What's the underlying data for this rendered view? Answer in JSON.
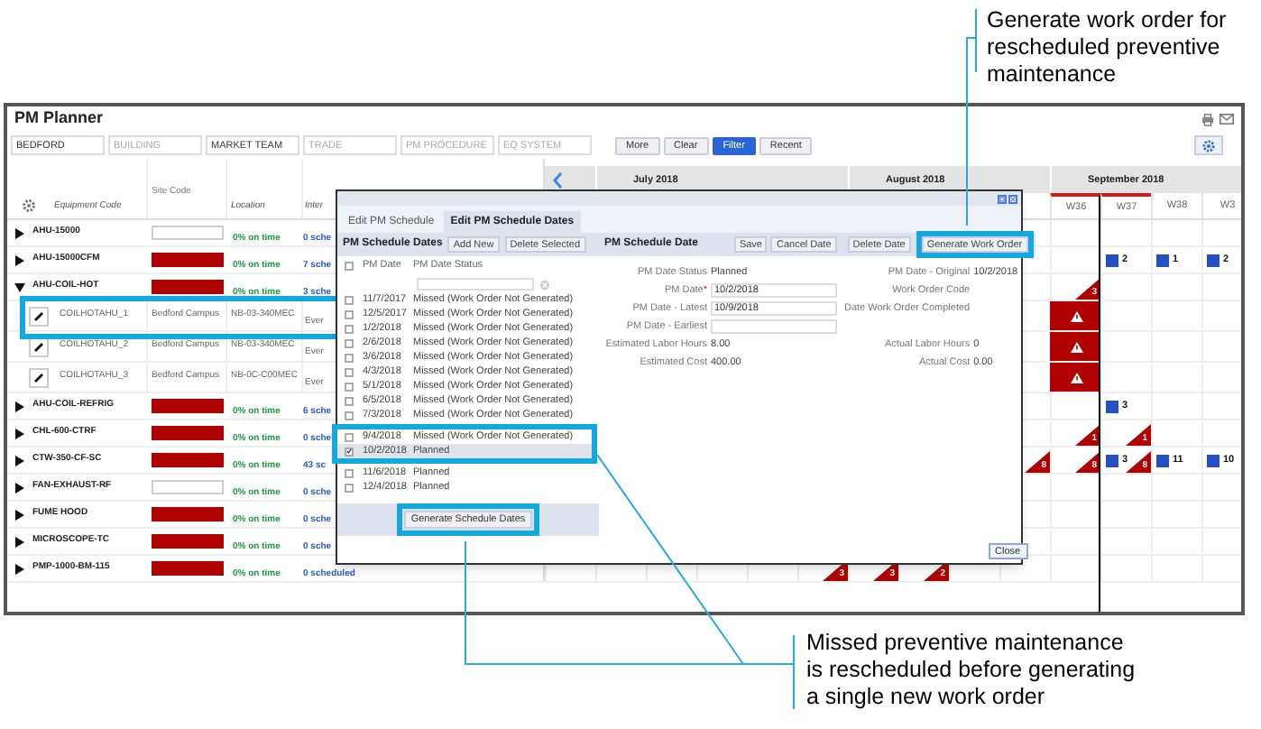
{
  "callouts": [
    {
      "lines": [
        "Generate work order for",
        "rescheduled preventive",
        "maintenance"
      ]
    },
    {
      "lines": [
        "Missed preventive maintenance",
        "is rescheduled before generating",
        "a single new work order"
      ]
    }
  ],
  "app": {
    "title": "PM Planner",
    "filters": [
      {
        "value": "BEDFORD"
      },
      {
        "placeholder": "BUILDING"
      },
      {
        "value": "MARKET TEAM"
      },
      {
        "placeholder": "TRADE"
      },
      {
        "placeholder": "PM PROCEDURE"
      },
      {
        "placeholder": "EQ SYSTEM"
      }
    ],
    "buttons": [
      {
        "label": "More",
        "selected": false
      },
      {
        "label": "Clear",
        "selected": false
      },
      {
        "label": "Filter",
        "selected": true
      },
      {
        "label": "Recent",
        "selected": false
      }
    ],
    "table": {
      "columns": [
        {
          "label": "Equipment Code"
        },
        {
          "label": "Site Code"
        },
        {
          "label": "Location"
        },
        {
          "label": "Inter"
        }
      ],
      "rows": [
        {
          "kind": "group",
          "code": "AHU-15000",
          "expanded": false,
          "flagged": false,
          "on_time": "0% on time",
          "scheduled": "0 sche"
        },
        {
          "kind": "group",
          "code": "AHU-15000CFM",
          "expanded": false,
          "flagged": true,
          "on_time": "0% on time",
          "scheduled": "7 sche",
          "markers": [
            {
              "kind": "count",
              "text": "2"
            },
            {
              "kind": "count",
              "text": "1"
            },
            {
              "kind": "count",
              "text": "2"
            }
          ]
        },
        {
          "kind": "group",
          "code": "AHU-COIL-HOT",
          "expanded": true,
          "flagged": true,
          "on_time": "0% on time",
          "scheduled": "3 sche",
          "markers": [
            {
              "kind": "overdue",
              "text": "3"
            }
          ]
        },
        {
          "kind": "item",
          "code": "COILHOTAHU_1",
          "site": "Bedford Campus",
          "location": "NB-03-340MEC",
          "column_4": "Ever",
          "markers": [
            {
              "kind": "alert"
            }
          ]
        },
        {
          "kind": "item",
          "code": "COILHOTAHU_2",
          "site": "Bedford Campus",
          "location": "NB-03-340MEC",
          "column_4": "Ever",
          "markers": [
            {
              "kind": "alert"
            }
          ]
        },
        {
          "kind": "item",
          "code": "COILHOTAHU_3",
          "site": "Bedford Campus",
          "location": "NB-0C-C00MEC",
          "column_4": "Ever",
          "markers": [
            {
              "kind": "alert"
            }
          ]
        },
        {
          "kind": "group",
          "code": "AHU-COIL-REFRIG",
          "expanded": false,
          "flagged": true,
          "on_time": "0% on time",
          "scheduled": "6 sche",
          "markers": [
            {
              "kind": "count",
              "text": "3"
            }
          ]
        },
        {
          "kind": "group",
          "code": "CHL-600-CTRF",
          "expanded": false,
          "flagged": true,
          "on_time": "0% on time",
          "scheduled": "0 sche",
          "markers": [
            {
              "kind": "overdue",
              "text": "1"
            },
            {
              "kind": "overdue",
              "text": "1"
            }
          ]
        },
        {
          "kind": "group",
          "code": "CTW-350-CF-SC",
          "expanded": false,
          "flagged": true,
          "on_time": "0% on time",
          "scheduled": "43 sc",
          "markers": [
            {
              "kind": "overdue",
              "text": "8"
            },
            {
              "kind": "overdue",
              "text": "8"
            },
            {
              "kind": "count",
              "text": "3"
            },
            {
              "kind": "overdue",
              "text": "8"
            },
            {
              "kind": "count",
              "text": "11"
            },
            {
              "kind": "count",
              "text": "10"
            }
          ]
        },
        {
          "kind": "group",
          "code": "FAN-EXHAUST-RF",
          "expanded": false,
          "flagged": false,
          "on_time": "0% on time",
          "scheduled": "0 sche"
        },
        {
          "kind": "group",
          "code": "FUME HOOD",
          "expanded": false,
          "flagged": true,
          "on_time": "0% on time",
          "scheduled": "0 sche"
        },
        {
          "kind": "group",
          "code": "MICROSCOPE-TC",
          "expanded": false,
          "flagged": true,
          "on_time": "0% on time",
          "scheduled": "0 sche"
        },
        {
          "kind": "group",
          "code": "PMP-1000-BM-115",
          "expanded": false,
          "flagged": true,
          "on_time": "0% on time",
          "scheduled": "0 scheduled",
          "markers": [
            {
              "kind": "overdue",
              "text": "3"
            },
            {
              "kind": "overdue",
              "text": "3"
            },
            {
              "kind": "overdue",
              "text": "2"
            }
          ]
        }
      ]
    },
    "timeline": {
      "months": [
        "July 2018",
        "August 2018",
        "September 2018"
      ],
      "weeks": [
        "W36",
        "W37",
        "W38",
        "W3"
      ]
    }
  },
  "dialog": {
    "tabs": [
      {
        "label": "Edit PM Schedule",
        "selected": false
      },
      {
        "label": "Edit PM Schedule Dates",
        "selected": true
      }
    ],
    "list_panel": {
      "title": "PM Schedule Dates",
      "buttons": [
        "Add New",
        "Delete Selected"
      ],
      "columns": [
        "PM Date",
        "PM Date Status"
      ],
      "all_checked": false,
      "rows": [
        {
          "date": "11/7/2017",
          "status": "Missed (Work Order Not Generated)",
          "checked": false,
          "selected": false
        },
        {
          "date": "12/5/2017",
          "status": "Missed (Work Order Not Generated)",
          "checked": false,
          "selected": false
        },
        {
          "date": "1/2/2018",
          "status": "Missed (Work Order Not Generated)",
          "checked": false,
          "selected": false
        },
        {
          "date": "2/6/2018",
          "status": "Missed (Work Order Not Generated)",
          "checked": false,
          "selected": false
        },
        {
          "date": "3/6/2018",
          "status": "Missed (Work Order Not Generated)",
          "checked": false,
          "selected": false
        },
        {
          "date": "4/3/2018",
          "status": "Missed (Work Order Not Generated)",
          "checked": false,
          "selected": false
        },
        {
          "date": "5/1/2018",
          "status": "Missed (Work Order Not Generated)",
          "checked": false,
          "selected": false
        },
        {
          "date": "6/5/2018",
          "status": "Missed (Work Order Not Generated)",
          "checked": false,
          "selected": false
        },
        {
          "date": "7/3/2018",
          "status": "Missed (Work Order Not Generated)",
          "checked": false,
          "selected": false
        },
        {
          "date": "9/4/2018",
          "status": "Missed (Work Order Not Generated)",
          "checked": false,
          "selected": false
        },
        {
          "date": "10/2/2018",
          "status": "Planned",
          "checked": true,
          "selected": true
        },
        {
          "date": "11/6/2018",
          "status": "Planned",
          "checked": false,
          "selected": false
        },
        {
          "date": "12/4/2018",
          "status": "Planned",
          "checked": false,
          "selected": false
        }
      ],
      "footer_button": "Generate Schedule Dates"
    },
    "detail_panel": {
      "title": "PM Schedule Date",
      "buttons": [
        "Save",
        "Cancel Date",
        "Delete Date",
        "Generate Work Order"
      ],
      "form_rows": [
        {
          "left": {
            "label": "PM Date Status",
            "kind": "text",
            "value": "Planned"
          },
          "right": {
            "label": "PM Date - Original",
            "value": "10/2/2018"
          }
        },
        {
          "left": {
            "label": "PM Date",
            "required_mark": "*",
            "kind": "input",
            "value": "10/2/2018"
          },
          "right": {
            "label": "Work Order Code"
          }
        },
        {
          "left": {
            "label": "PM Date - Latest",
            "kind": "input",
            "value": "10/9/2018"
          },
          "right": {
            "label": "Date Work Order Completed"
          }
        },
        {
          "left": {
            "label": "PM Date - Earliest",
            "kind": "input"
          }
        },
        {
          "left": {
            "label": "Estimated Labor Hours",
            "kind": "text",
            "value": "8.00"
          },
          "right": {
            "label": "Actual Labor Hours",
            "value": "0"
          }
        },
        {
          "left": {
            "label": "Estimated Cost",
            "kind": "text",
            "value": "400.00"
          },
          "right": {
            "label": "Actual Cost",
            "value": "0.00"
          }
        }
      ],
      "close_button": "Close"
    }
  }
}
